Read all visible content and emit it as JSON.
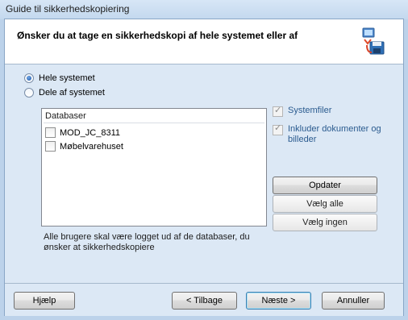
{
  "window": {
    "title": "Guide til sikkerhedskopiering"
  },
  "header": {
    "question": "Ønsker du at tage en sikkerhedskopi af hele systemet eller af",
    "icon": "backup-computer-icon"
  },
  "scope": {
    "options": [
      {
        "label": "Hele systemet",
        "selected": true
      },
      {
        "label": "Dele af systemet",
        "selected": false
      }
    ]
  },
  "databases": {
    "header": "Databaser",
    "items": [
      {
        "label": "MOD_JC_8311",
        "checked": false
      },
      {
        "label": "Møbelvarehuset",
        "checked": false
      }
    ]
  },
  "options": {
    "systemfiles": {
      "label": "Systemfiler",
      "checked": true
    },
    "include_docs": {
      "label": "Inkluder dokumenter og billeder",
      "checked": true
    }
  },
  "buttons": {
    "update": "Opdater",
    "select_all": "Vælg alle",
    "select_none": "Vælg ingen",
    "help": "Hjælp",
    "back": "< Tilbage",
    "next": "Næste >",
    "cancel": "Annuller"
  },
  "note": "Alle brugere skal være logget ud af de databaser, du ønsker at sikkerhedskopiere"
}
